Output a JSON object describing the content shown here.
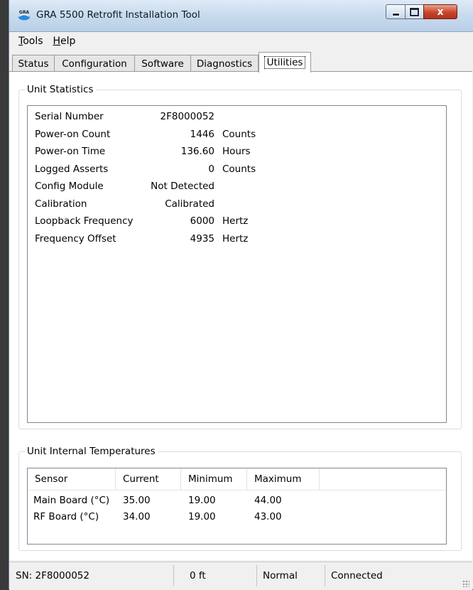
{
  "window": {
    "title": "GRA 5500 Retrofit Installation Tool",
    "icon_label": "GRA",
    "controls": {
      "minimize": "minimize-icon",
      "maximize": "maximize-icon",
      "close_glyph": "x"
    }
  },
  "menu": {
    "items": [
      {
        "label": "Tools",
        "accel_index": 0
      },
      {
        "label": "Help",
        "accel_index": 0
      }
    ]
  },
  "tabs": [
    {
      "label": "Status",
      "active": false
    },
    {
      "label": "Configuration",
      "active": false
    },
    {
      "label": "Software",
      "active": false
    },
    {
      "label": "Diagnostics",
      "active": false
    },
    {
      "label": "Utilities",
      "active": true
    }
  ],
  "unit_statistics": {
    "title": "Unit Statistics",
    "rows": [
      {
        "name": "Serial Number",
        "value": "2F8000052",
        "unit": ""
      },
      {
        "name": "Power-on Count",
        "value": "1446",
        "unit": "Counts"
      },
      {
        "name": "Power-on Time",
        "value": "136.60",
        "unit": "Hours"
      },
      {
        "name": "Logged Asserts",
        "value": "0",
        "unit": "Counts"
      },
      {
        "name": "Config Module",
        "value": "Not Detected",
        "unit": ""
      },
      {
        "name": "Calibration",
        "value": "Calibrated",
        "unit": ""
      },
      {
        "name": "Loopback Frequency",
        "value": "6000",
        "unit": "Hertz"
      },
      {
        "name": "Frequency Offset",
        "value": "4935",
        "unit": "Hertz"
      }
    ]
  },
  "temperatures": {
    "title": "Unit Internal Temperatures",
    "columns": [
      "Sensor",
      "Current",
      "Minimum",
      "Maximum"
    ],
    "rows": [
      {
        "sensor": "Main Board (°C)",
        "current": "35.00",
        "minimum": "19.00",
        "maximum": "44.00"
      },
      {
        "sensor": "RF Board (°C)",
        "current": "34.00",
        "minimum": "19.00",
        "maximum": "43.00"
      }
    ]
  },
  "statusbar": {
    "serial": "SN: 2F8000052",
    "altitude": "0 ft",
    "mode": "Normal",
    "connection": "Connected"
  },
  "colors": {
    "titlebar": "#c9dcef",
    "close_button": "#c8452c",
    "window_bg": "#f0f0f0",
    "panel_bg": "#ffffff"
  }
}
